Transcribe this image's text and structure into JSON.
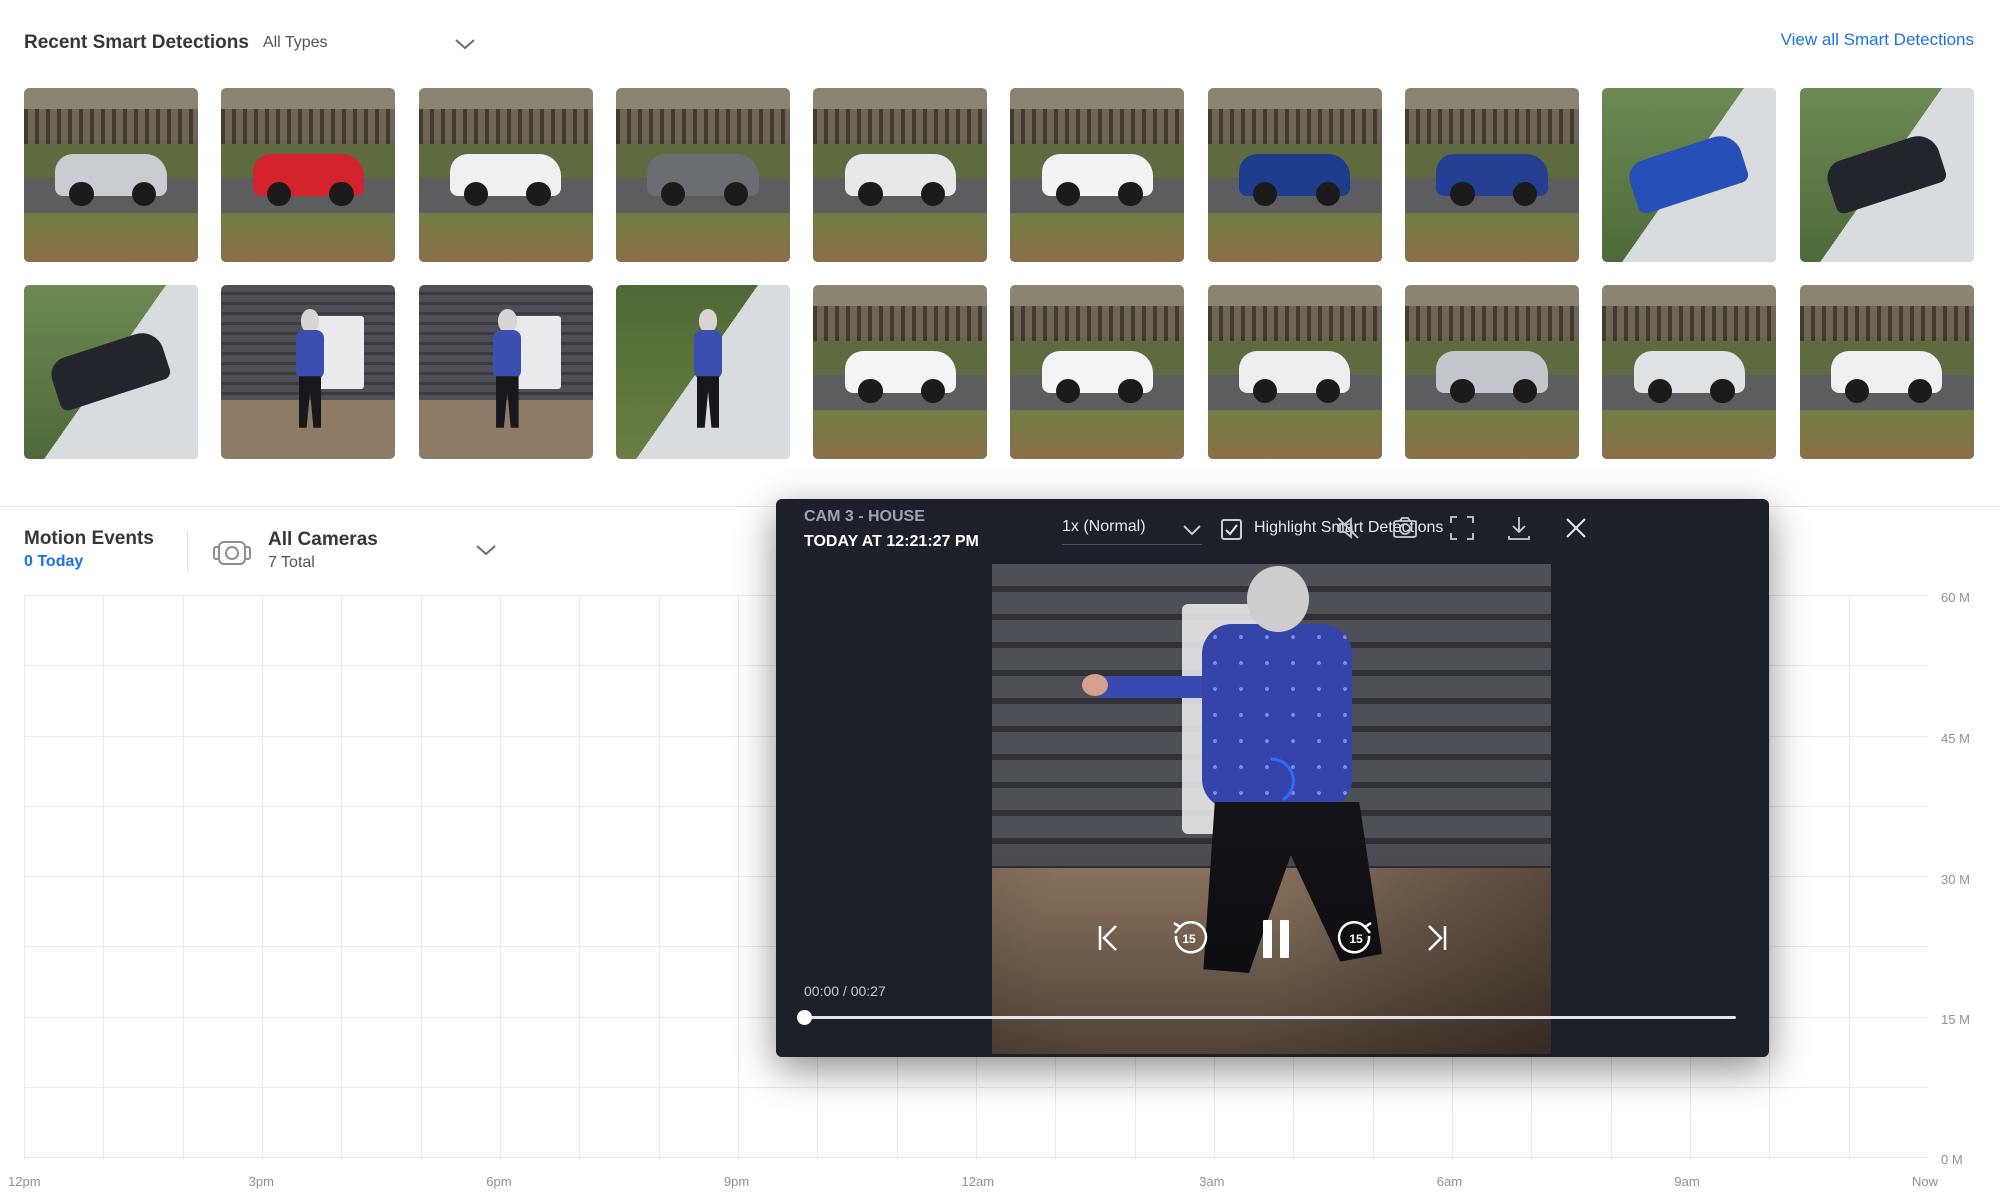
{
  "smart_detections": {
    "title": "Recent Smart Detections",
    "filter_value": "All Types",
    "view_all_label": "View all Smart Detections",
    "thumbnails": [
      {
        "kind": "car",
        "car_color": "#c9cdd1"
      },
      {
        "kind": "car",
        "car_color": "#d3242e"
      },
      {
        "kind": "car",
        "car_color": "#eef0f2"
      },
      {
        "kind": "car",
        "car_color": "#6a6e73"
      },
      {
        "kind": "car",
        "car_color": "#e6e8ea"
      },
      {
        "kind": "car",
        "car_color": "#f2f3f5"
      },
      {
        "kind": "car",
        "car_color": "#1e3c8c"
      },
      {
        "kind": "car",
        "car_color": "#243f91"
      },
      {
        "kind": "driveway",
        "car_color": "#2450b8"
      },
      {
        "kind": "driveway",
        "car_color": "#22252c"
      },
      {
        "kind": "driveway",
        "car_color": "#22252c"
      },
      {
        "kind": "person",
        "car_color": ""
      },
      {
        "kind": "person",
        "car_color": ""
      },
      {
        "kind": "person-path",
        "car_color": ""
      },
      {
        "kind": "car",
        "car_color": "#f3f4f5"
      },
      {
        "kind": "car",
        "car_color": "#f3f4f5"
      },
      {
        "kind": "car",
        "car_color": "#eceef0"
      },
      {
        "kind": "car",
        "car_color": "#c3c7cb"
      },
      {
        "kind": "car",
        "car_color": "#dfe2e5"
      },
      {
        "kind": "car",
        "car_color": "#eef0f2"
      }
    ]
  },
  "motion_events": {
    "title": "Motion Events",
    "today": "0 Today",
    "camera_label": "All Cameras",
    "camera_total": "7 Total"
  },
  "chart_data": {
    "type": "bar",
    "categories": [
      "12pm",
      "3pm",
      "6pm",
      "9pm",
      "12am",
      "3am",
      "6am",
      "9am",
      "Now"
    ],
    "series": [],
    "y_ticks": [
      "60 M",
      "45 M",
      "30 M",
      "15 M",
      "0 M"
    ],
    "ylim": [
      0,
      60
    ],
    "grid": true
  },
  "player": {
    "camera_name": "CAM 3 - HOUSE",
    "timestamp": "TODAY AT 12:21:27 PM",
    "speed": "1x (Normal)",
    "highlight_label": "Highlight Smart Detections",
    "highlight_checked": true,
    "time_display": "00:00 / 00:27",
    "progress": 0,
    "skip_back_label": "15",
    "skip_forward_label": "15"
  },
  "colors": {
    "accent": "#1a73e8",
    "player_bg": "#1d2029",
    "spinner": "#2f6bff"
  }
}
